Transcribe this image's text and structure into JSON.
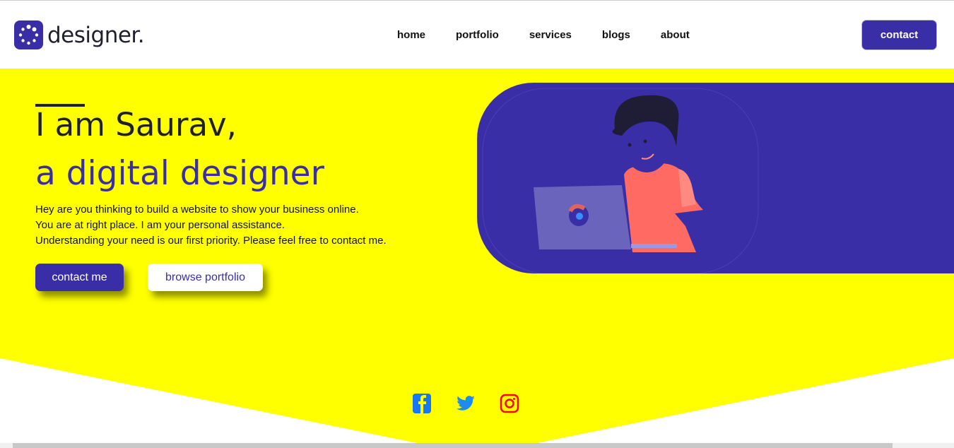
{
  "header": {
    "brand": "designer.",
    "nav": [
      "home",
      "portfolio",
      "services",
      "blogs",
      "about"
    ],
    "contact_label": "contact"
  },
  "hero": {
    "line1": "I am Saurav,",
    "line2": "a digital designer",
    "description": [
      "Hey are you thinking to build a website to show your business online.",
      "You are at right place. I am your personal assistance.",
      "Understanding your need is our first priority. Please feel free to contact me."
    ],
    "primary_button": "contact me",
    "secondary_button": "browse portfolio"
  },
  "social": [
    "facebook-icon",
    "twitter-icon",
    "instagram-icon"
  ],
  "colors": {
    "accent": "#3a2ea6",
    "hero_bg": "#ffff00",
    "facebook": "#1877f2",
    "twitter": "#1d8cf2",
    "instagram": "#ff0000"
  }
}
